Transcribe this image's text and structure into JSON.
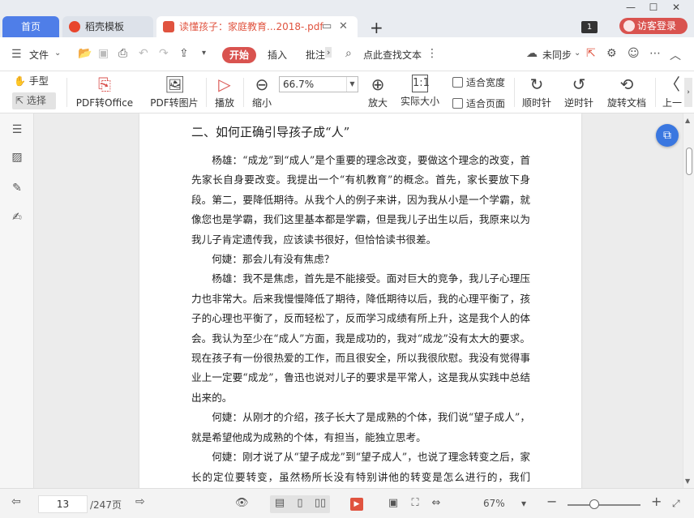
{
  "tabs": {
    "home": "首页",
    "template": "稻壳模板",
    "document": "读懂孩子：家庭教育...2018-.pdf",
    "add": "+"
  },
  "window": {
    "page_count_badge": "1",
    "login": "访客登录"
  },
  "menu": {
    "file": "文件",
    "start": "开始",
    "insert": "插入",
    "annotate": "批注",
    "search": "点此查找文本",
    "sync": "未同步"
  },
  "ribbon": {
    "hand": "手型",
    "select": "选择",
    "pdf_to_office": "PDF转Office",
    "pdf_to_image": "PDF转图片",
    "play": "播放",
    "zoom_out": "缩小",
    "zoom_value": "66.7%",
    "zoom_in": "放大",
    "actual_size": "实际大小",
    "fit_width": "适合宽度",
    "fit_page": "适合页面",
    "clockwise": "顺时针",
    "counterclockwise": "逆时针",
    "rotate_doc": "旋转文档",
    "prev": "上一"
  },
  "document": {
    "heading": "二、如何正确引导孩子成“人”",
    "paragraphs": [
      "杨雄：“成龙”到“成人”是个重要的理念改变，要做这个理念的改变，首先家长自身要改变。我提出一个“有机教育”的概念。首先，家长要放下身段。第二，要降低期待。从我个人的例子来讲，因为我从小是一个学霸，就像您也是学霸，我们这里基本都是学霸，但是我儿子出生以后，我原来以为我儿子肯定遗传我，应该读书很好，但恰恰读书很差。",
      "何婕：那会儿有没有焦虑？",
      "杨雄：我不是焦虑，首先是不能接受。面对巨大的竞争，我儿子心理压力也非常大。后来我慢慢降低了期待，降低期待以后，我的心理平衡了，孩子的心理也平衡了，反而轻松了，反而学习成绩有所上升，这是我个人的体会。我认为至少在“成人”方面，我是成功的，我对“成龙”没有太大的要求。现在孩子有一份很热爱的工作，而且很安全，所以我很欣慰。我没有觉得事业上一定要“成龙”，鲁迅也说对儿子的要求是平常人，这是我从实践中总结出来的。",
      "何婕：从刚才的介绍，孩子长大了是成熟的个体，我们说“望子成人”，就是希望他成为成熟的个体，有担当，能独立思考。",
      "何婕：刚才说了从“望子成龙”到“望子成人”，也说了理念转变之后，家长的定位要转变，虽然杨所长没有特别讲他的转变是怎么进行的，我们的……"
    ]
  },
  "status": {
    "page_current": "13",
    "page_total": "/247页",
    "zoom_percent": "67%"
  },
  "colors": {
    "accent_blue": "#4f7ee8",
    "accent_red": "#d9534f"
  }
}
